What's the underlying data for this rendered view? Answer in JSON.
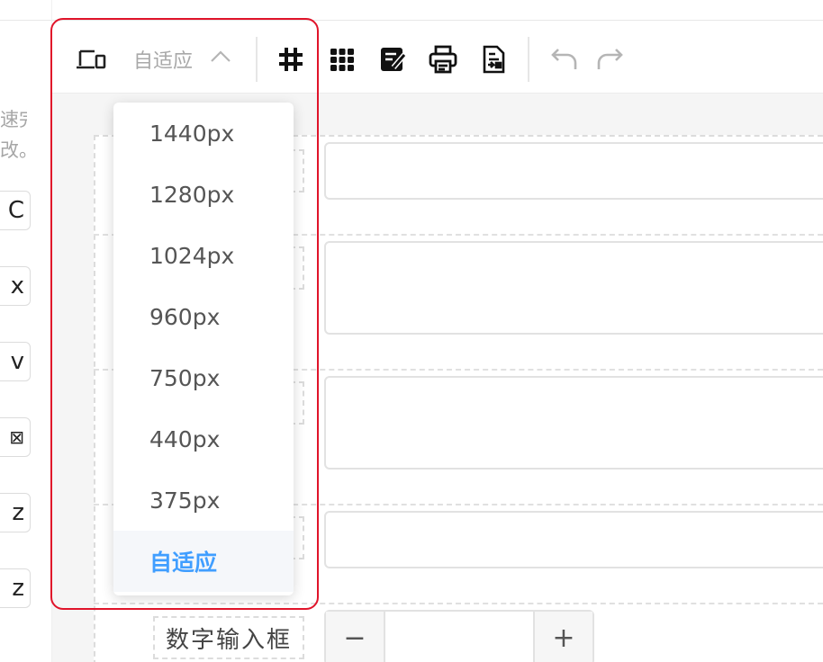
{
  "left_panel": {
    "hint_lines": [
      "速完",
      "改。"
    ],
    "buttons": [
      "C",
      "x",
      "v",
      "⊠",
      "z",
      "z"
    ]
  },
  "toolbar": {
    "device_icon": "device-icon",
    "size_value": "自适应",
    "chevron": "chevron-up-icon",
    "tools": [
      "grid-hash-icon",
      "grid-dots-icon",
      "edit-note-icon",
      "printer-icon",
      "document-export-icon"
    ],
    "history": [
      "undo-icon",
      "redo-icon"
    ]
  },
  "dropdown": {
    "options": [
      "1440px",
      "1280px",
      "1024px",
      "960px",
      "750px",
      "440px",
      "375px",
      "自适应"
    ],
    "selected": "自适应"
  },
  "form": {
    "number_label": "数字输入框",
    "stepper_minus": "−",
    "stepper_plus": "+"
  },
  "colors": {
    "accent": "#409eff",
    "highlight": "#e0142a"
  }
}
